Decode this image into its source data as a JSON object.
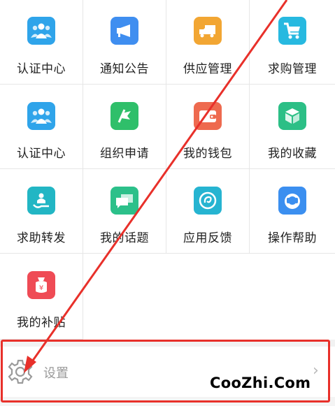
{
  "menu_items": [
    {
      "label": "认证中心",
      "icon": "people-icon",
      "color": "#2fa4ea"
    },
    {
      "label": "通知公告",
      "icon": "megaphone-icon",
      "color": "#3f8ef0"
    },
    {
      "label": "供应管理",
      "icon": "truck-icon",
      "color": "#f2a633"
    },
    {
      "label": "求购管理",
      "icon": "cart-icon",
      "color": "#27b9e0"
    },
    {
      "label": "认证中心",
      "icon": "people-icon",
      "color": "#2fa4ea"
    },
    {
      "label": "组织申请",
      "icon": "flag-icon",
      "color": "#2fbf6a"
    },
    {
      "label": "我的钱包",
      "icon": "wallet-icon",
      "color": "#ee6a4f"
    },
    {
      "label": "我的收藏",
      "icon": "cube-icon",
      "color": "#2cbf86"
    },
    {
      "label": "求助转发",
      "icon": "help-forward-icon",
      "color": "#22b6c4"
    },
    {
      "label": "我的话题",
      "icon": "chat-icon",
      "color": "#2cc08a"
    },
    {
      "label": "应用反馈",
      "icon": "feedback-icon",
      "color": "#26b4d1"
    },
    {
      "label": "操作帮助",
      "icon": "headset-icon",
      "color": "#3b8ff0"
    },
    {
      "label": "我的补贴",
      "icon": "subsidy-bag-icon",
      "color": "#ef4b55"
    }
  ],
  "settings": {
    "label": "设置",
    "icon": "gear-icon"
  },
  "watermark": "CooZhi.Com",
  "annotation_color": "#e8302a"
}
